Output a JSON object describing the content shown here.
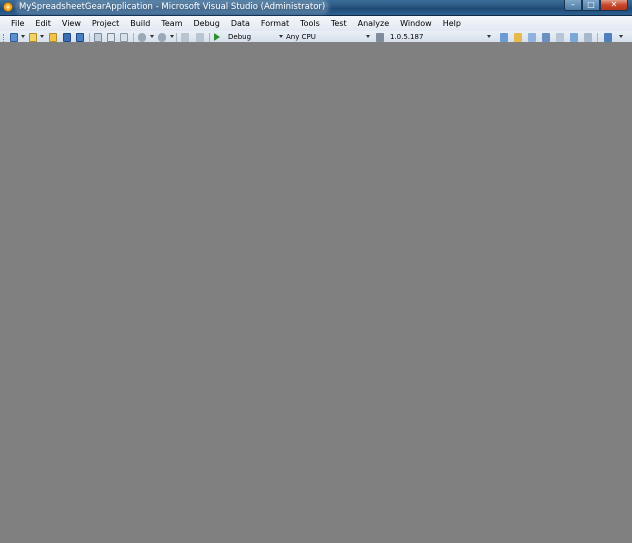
{
  "window": {
    "title": "MySpreadsheetGearApplication - Microsoft Visual Studio (Administrator)",
    "buttons": {
      "minimize": "–",
      "maximize": "□",
      "close": "✕"
    }
  },
  "menu": {
    "items": [
      "File",
      "Edit",
      "View",
      "Project",
      "Build",
      "Team",
      "Debug",
      "Data",
      "Format",
      "Tools",
      "Test",
      "Analyze",
      "Window",
      "Help"
    ]
  },
  "toolbar": {
    "config_combo": "Debug",
    "platform_combo": "Any CPU",
    "version_combo": "1.0.5.187"
  },
  "icons": {
    "app": "visual-studio-icon"
  },
  "colors": {
    "titlebar": "#2a557f",
    "menubar": "#e2e9f2",
    "workspace": "#808080",
    "close_button": "#c8462a"
  }
}
